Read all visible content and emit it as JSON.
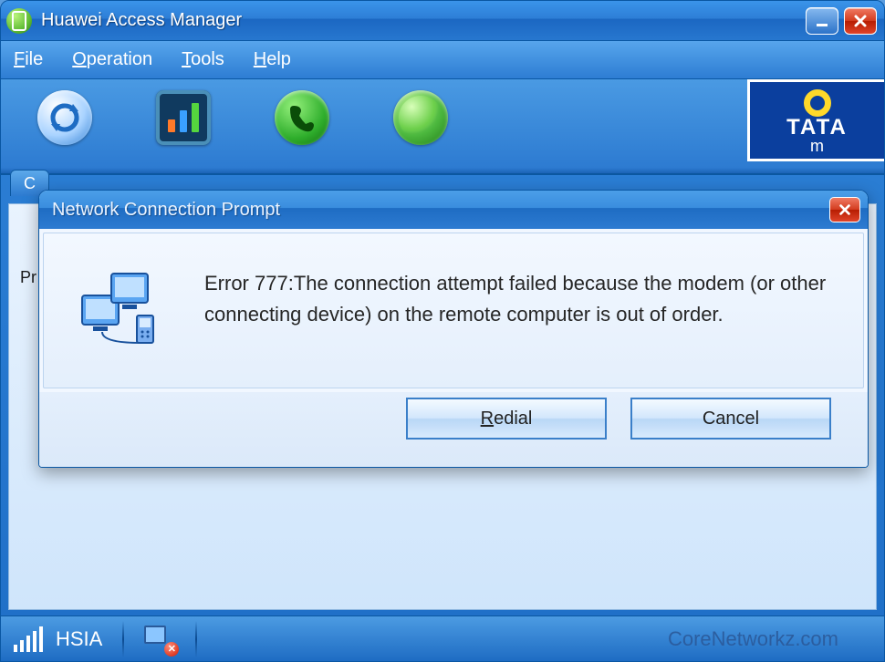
{
  "window": {
    "title": "Huawei Access Manager"
  },
  "menu": {
    "file": "File",
    "operation": "Operation",
    "tools": "Tools",
    "help": "Help"
  },
  "toolbar": {
    "sync_icon": "sync",
    "stats_icon": "statistics",
    "phone_icon": "phone",
    "globe_icon": "globe"
  },
  "brand": {
    "line1": "TATA",
    "line2": "m"
  },
  "tab": {
    "active_partial": "C"
  },
  "content": {
    "label_partial": "Pr"
  },
  "dialog": {
    "title": "Network Connection Prompt",
    "message": "Error 777:The connection attempt failed because the modem (or other connecting device) on the remote computer is out of order.",
    "redial": "Redial",
    "cancel": "Cancel"
  },
  "status": {
    "network": "HSIA",
    "watermark": "CoreNetworkz.com"
  }
}
